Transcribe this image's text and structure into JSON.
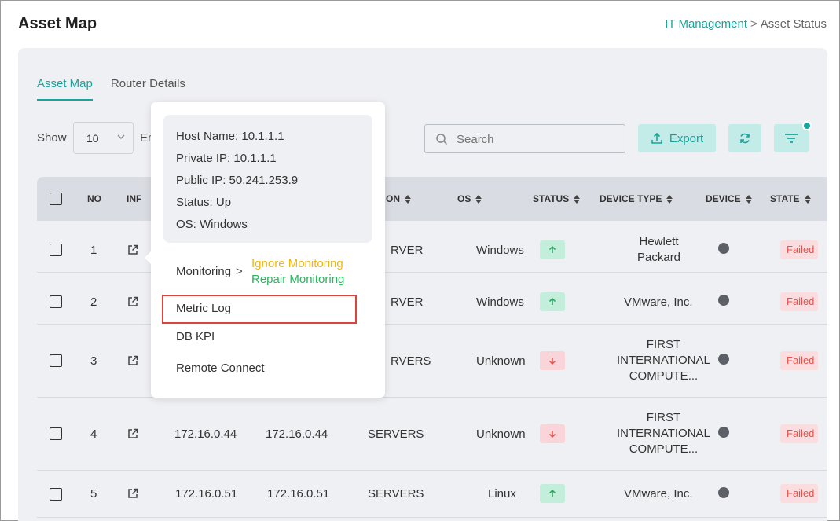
{
  "page": {
    "title": "Asset Map",
    "breadcrumb": {
      "parent": "IT Management",
      "separator": ">",
      "current": "Asset Status"
    }
  },
  "tabs": [
    {
      "label": "Asset Map",
      "active": true
    },
    {
      "label": "Router Details",
      "active": false
    }
  ],
  "toolbar": {
    "show_label": "Show",
    "page_size": "10",
    "entries_label": "En",
    "search_placeholder": "Search",
    "export_label": "Export"
  },
  "table": {
    "headers": [
      "NO",
      "INF",
      "ON",
      "OS",
      "STATUS",
      "DEVICE TYPE",
      "DEVICE",
      "STATE"
    ],
    "rows": [
      {
        "no": "1",
        "col1": "",
        "col2": "",
        "col3": "RVER",
        "os": "Windows",
        "status": "up",
        "device_type": [
          "Hewlett",
          "Packard"
        ],
        "state": "Failed"
      },
      {
        "no": "2",
        "col1": "",
        "col2": "",
        "col3": "RVER",
        "os": "Windows",
        "status": "up",
        "device_type": [
          "VMware, Inc."
        ],
        "state": "Failed"
      },
      {
        "no": "3",
        "col1": "",
        "col2": "",
        "col3": "RVERS",
        "os": "Unknown",
        "status": "down",
        "device_type": [
          "FIRST",
          "INTERNATIONAL",
          "COMPUTE..."
        ],
        "state": "Failed"
      },
      {
        "no": "4",
        "col1": "172.16.0.44",
        "col2": "172.16.0.44",
        "col3": "SERVERS",
        "os": "Unknown",
        "status": "down",
        "device_type": [
          "FIRST",
          "INTERNATIONAL",
          "COMPUTE..."
        ],
        "state": "Failed"
      },
      {
        "no": "5",
        "col1": "172.16.0.51",
        "col2": "172.16.0.51",
        "col3": "SERVERS",
        "os": "Linux",
        "status": "up",
        "device_type": [
          "VMware, Inc."
        ],
        "state": "Failed"
      }
    ]
  },
  "popup": {
    "info": {
      "host_name": "Host Name: 10.1.1.1",
      "private_ip": "Private IP: 10.1.1.1",
      "public_ip": "Public IP: 50.241.253.9",
      "status": "Status: Up",
      "os": "OS: Windows"
    },
    "monitoring_label": "Monitoring",
    "monitoring_chevron": ">",
    "ignore_monitoring": "Ignore Monitoring",
    "repair_monitoring": "Repair Monitoring",
    "metric_log": "Metric Log",
    "db_kpi": "DB KPI",
    "remote_connect": "Remote Connect"
  },
  "colors": {
    "accent": "#1aa39a",
    "status_up_bg": "#c2eedb",
    "status_down_bg": "#f9d4d8",
    "failed_text": "#e5534b",
    "ignore_monitoring": "#f2b705",
    "repair_monitoring": "#27b65b",
    "highlight": "#d9453c"
  }
}
